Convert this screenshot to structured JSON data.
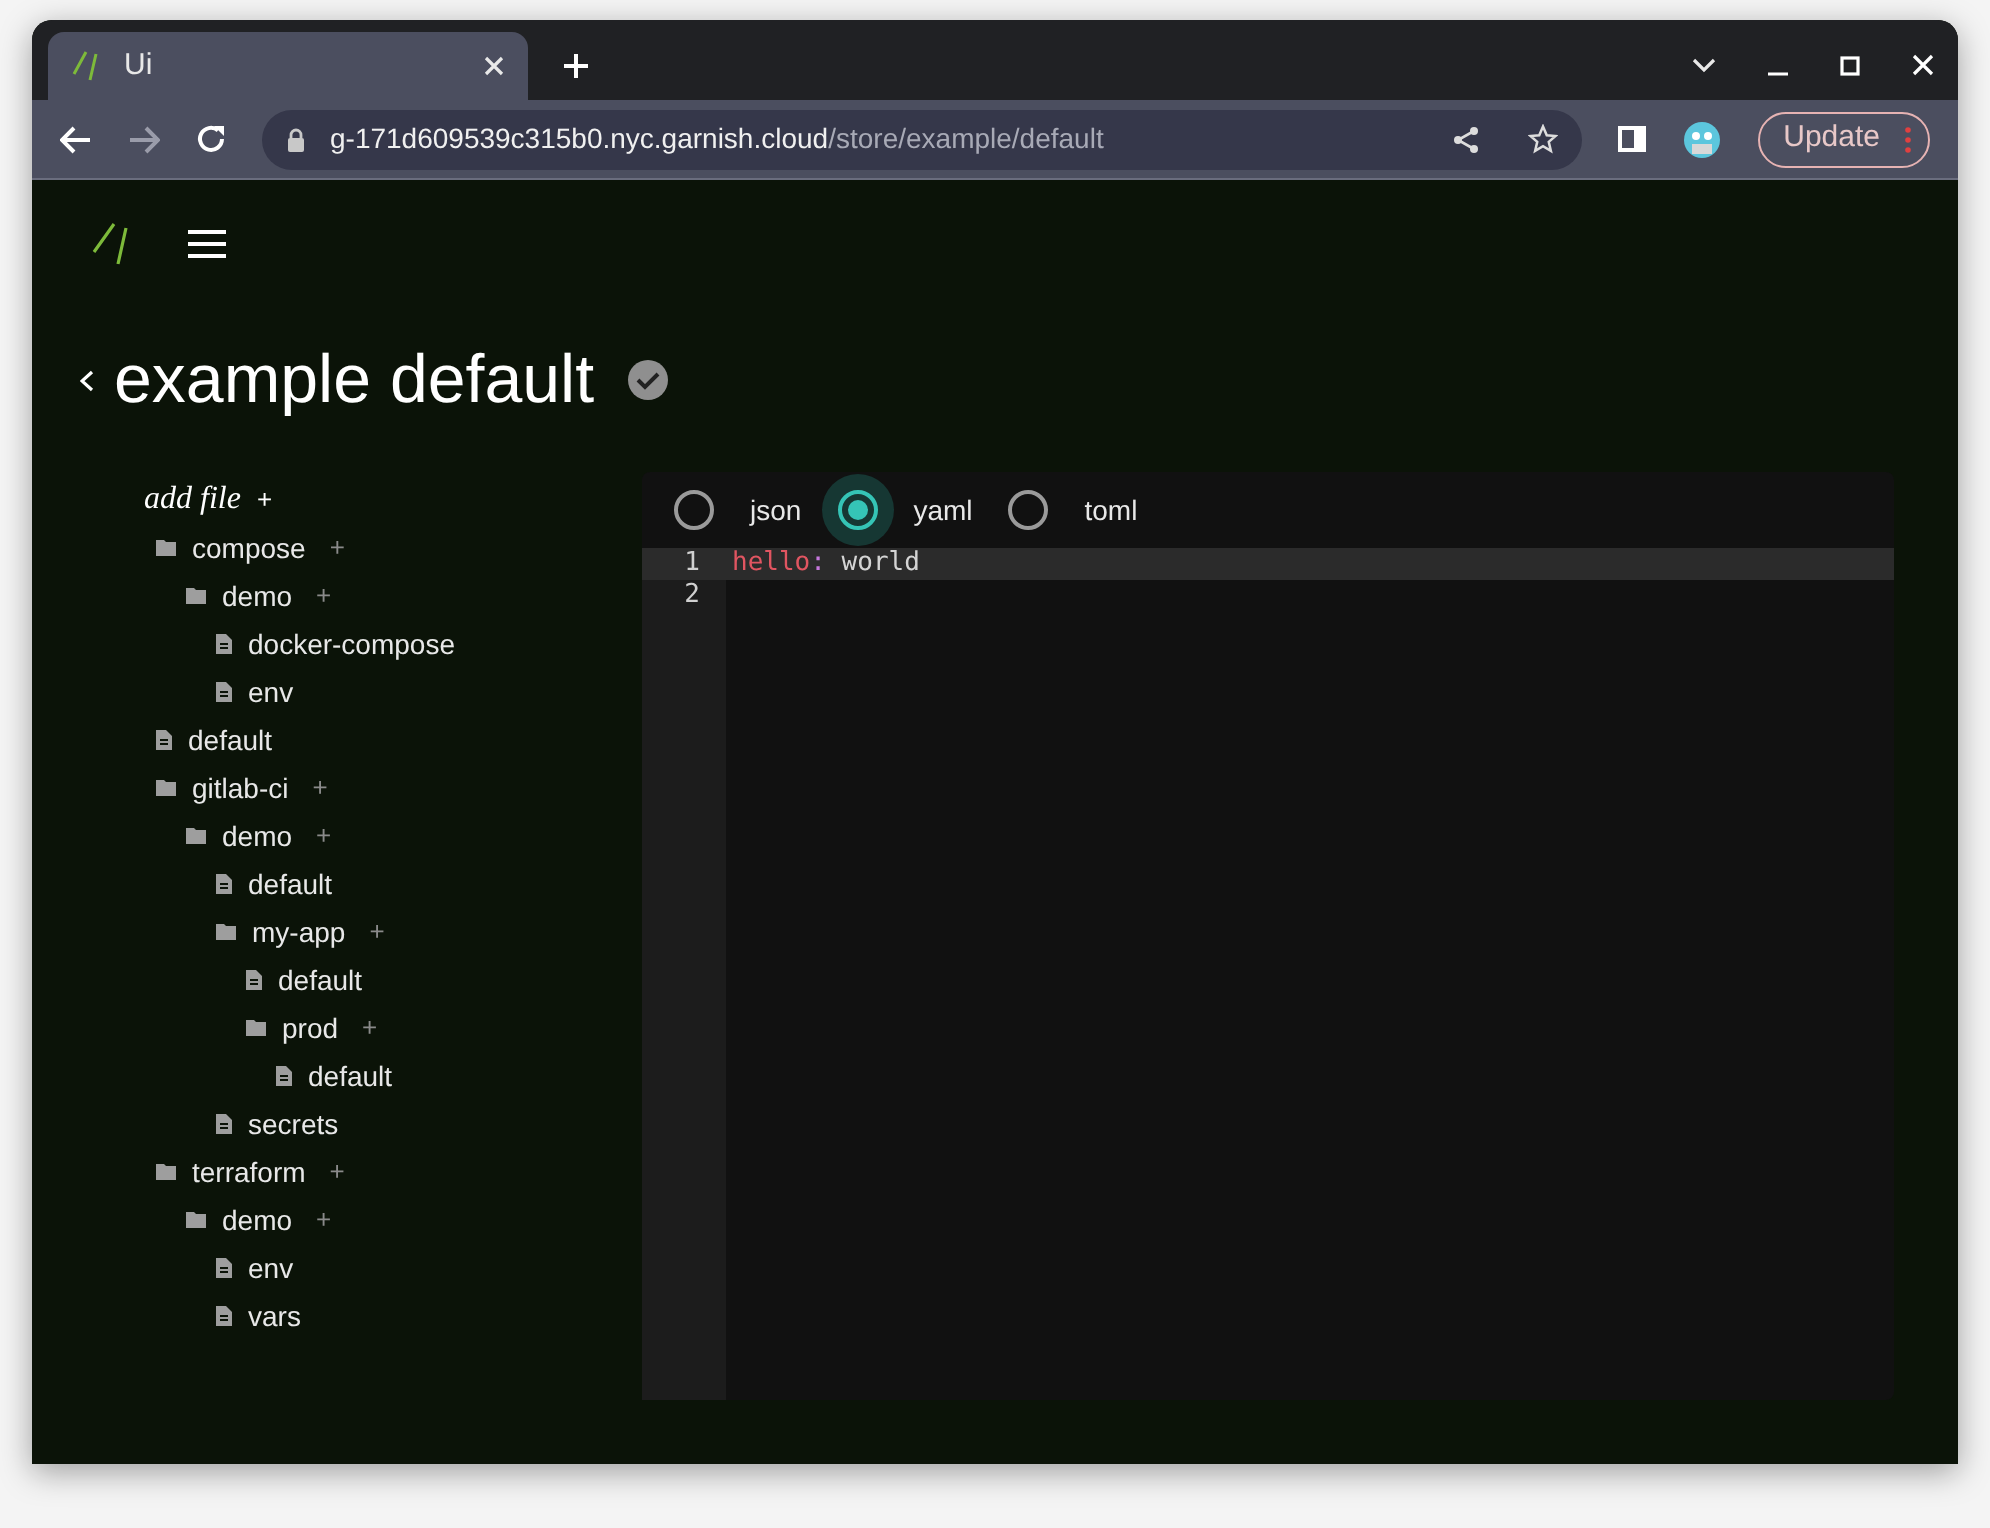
{
  "browser": {
    "tab_title": "Ui",
    "url_host": "g-171d609539c315b0.nyc.garnish.cloud",
    "url_path": "/store/example/default",
    "update_button": "Update"
  },
  "page": {
    "title": "example default",
    "saved": true
  },
  "tree": {
    "add_label": "add file",
    "add_plus": "+",
    "items": [
      {
        "kind": "folder",
        "name": "compose",
        "children": [
          {
            "kind": "folder",
            "name": "demo",
            "children": [
              {
                "kind": "file",
                "name": "docker-compose"
              },
              {
                "kind": "file",
                "name": "env"
              }
            ]
          }
        ]
      },
      {
        "kind": "file",
        "name": "default"
      },
      {
        "kind": "folder",
        "name": "gitlab-ci",
        "children": [
          {
            "kind": "folder",
            "name": "demo",
            "children": [
              {
                "kind": "file",
                "name": "default"
              },
              {
                "kind": "folder",
                "name": "my-app",
                "children": [
                  {
                    "kind": "file",
                    "name": "default"
                  },
                  {
                    "kind": "folder",
                    "name": "prod",
                    "children": [
                      {
                        "kind": "file",
                        "name": "default"
                      }
                    ]
                  }
                ]
              },
              {
                "kind": "file",
                "name": "secrets"
              }
            ]
          }
        ]
      },
      {
        "kind": "folder",
        "name": "terraform",
        "children": [
          {
            "kind": "folder",
            "name": "demo",
            "children": [
              {
                "kind": "file",
                "name": "env"
              },
              {
                "kind": "file",
                "name": "vars"
              }
            ]
          }
        ]
      }
    ]
  },
  "editor": {
    "formats": [
      {
        "label": "json",
        "selected": false
      },
      {
        "label": "yaml",
        "selected": true
      },
      {
        "label": "toml",
        "selected": false
      }
    ],
    "lines": [
      {
        "number": "1",
        "active": true,
        "tokens": [
          {
            "kind": "key",
            "text": "hello"
          },
          {
            "kind": "punct",
            "text": ":"
          },
          {
            "kind": "plain",
            "text": " world"
          }
        ]
      },
      {
        "number": "2",
        "active": false
      }
    ]
  }
}
